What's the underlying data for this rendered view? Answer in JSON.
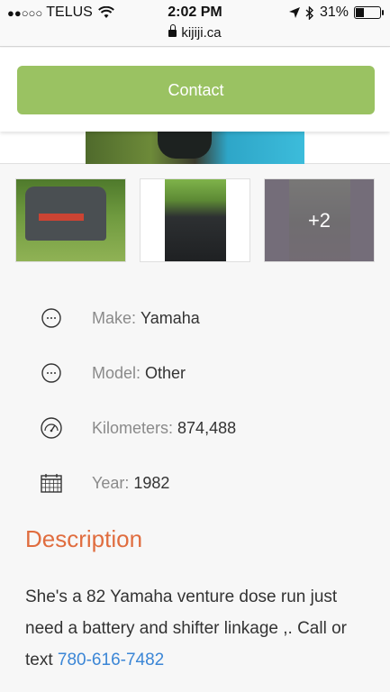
{
  "status_bar": {
    "signal_dots": "●●○○○",
    "carrier": "TELUS",
    "time": "2:02 PM",
    "battery_percent": "31%",
    "battery_level": 0.31,
    "icons": [
      "wifi-icon",
      "location-arrow-icon",
      "bluetooth-icon",
      "battery-icon"
    ]
  },
  "url_bar": {
    "domain": "kijiji.ca"
  },
  "contact_button": {
    "label": "Contact",
    "color": "#9ac262"
  },
  "thumbnails": {
    "more_count": "+2"
  },
  "attributes": [
    {
      "label": "Make:",
      "value": "Yamaha",
      "icon": "tag-icon"
    },
    {
      "label": "Model:",
      "value": "Other",
      "icon": "tag-icon"
    },
    {
      "label": "Kilometers:",
      "value": "874,488",
      "icon": "speedometer-icon"
    },
    {
      "label": "Year:",
      "value": "1982",
      "icon": "calendar-icon"
    }
  ],
  "description": {
    "title": "Description",
    "text": "She's a 82 Yamaha venture dose run just need a battery and shifter linkage ,. Call or text ",
    "phone": "780-616-7482",
    "title_color": "#e06d3f",
    "link_color": "#3b86d6"
  }
}
